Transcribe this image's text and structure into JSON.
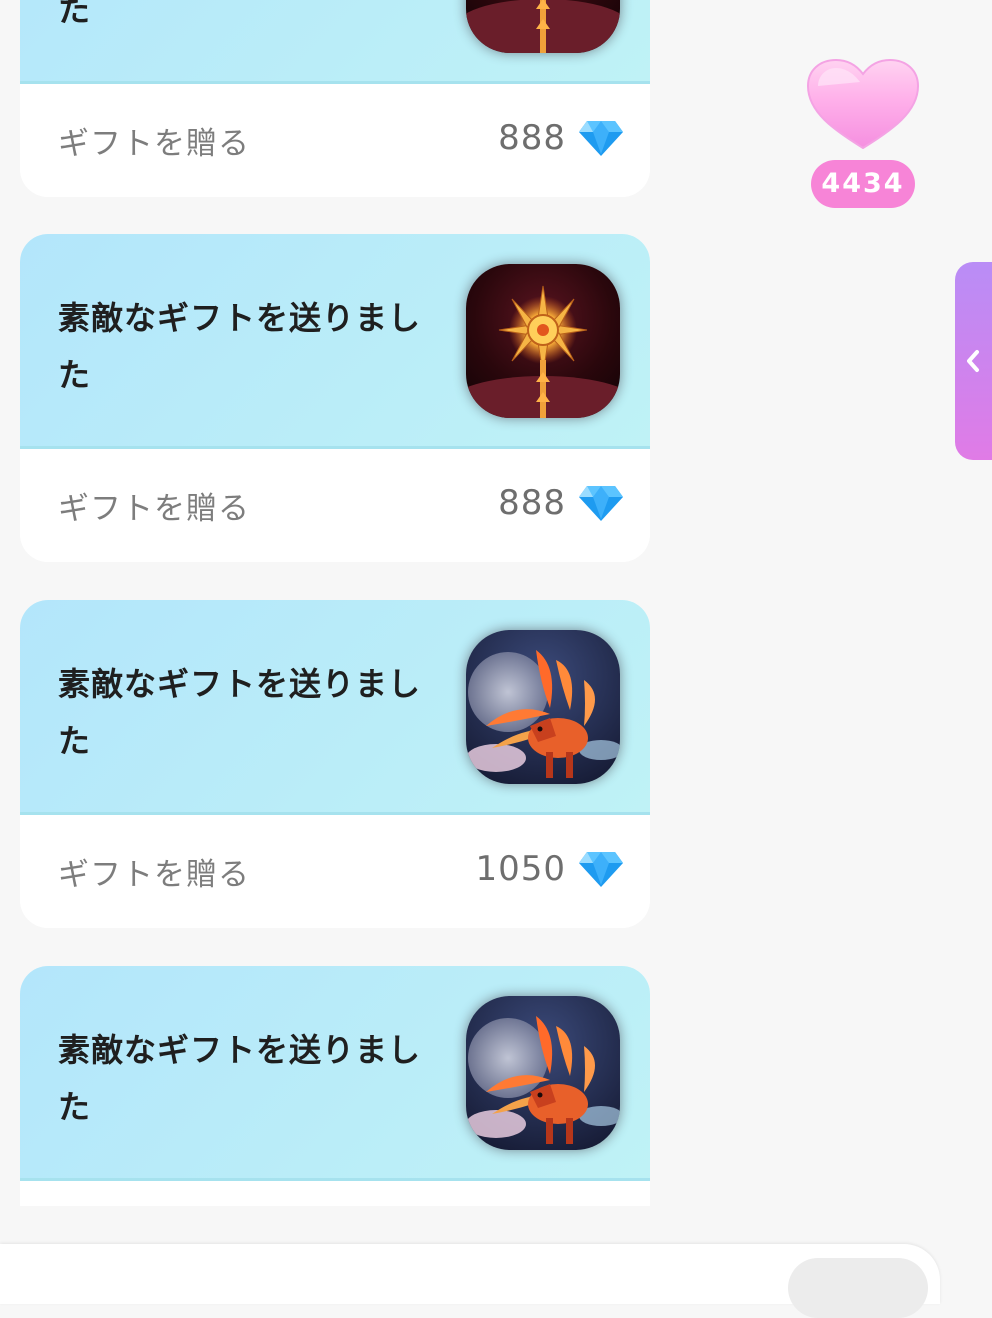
{
  "gift_feed": {
    "cards": [
      {
        "message": "素敵なギフトを送りました",
        "gift_icon": "golden-star-staff-icon",
        "send_label": "ギフトを贈る",
        "price": "888",
        "currency_icon": "diamond-icon"
      },
      {
        "message": "素敵なギフトを送りました",
        "gift_icon": "golden-star-staff-icon",
        "send_label": "ギフトを贈る",
        "price": "888",
        "currency_icon": "diamond-icon"
      },
      {
        "message": "素敵なギフトを送りました",
        "gift_icon": "fire-fox-icon",
        "send_label": "ギフトを贈る",
        "price": "1050",
        "currency_icon": "diamond-icon"
      },
      {
        "message": "素敵なギフトを送りました",
        "gift_icon": "fire-fox-icon"
      }
    ]
  },
  "heart_widget": {
    "icon": "pink-heart-icon",
    "count": "4434"
  },
  "side_tab": {
    "icon": "chevron-left-icon"
  },
  "colors": {
    "card_top_bg": "#b9edf8",
    "heart_badge": "#f784d7",
    "side_tab_gradient_start": "#b98df6",
    "side_tab_gradient_end": "#e07be6",
    "diamond": "#1e9bf0"
  }
}
